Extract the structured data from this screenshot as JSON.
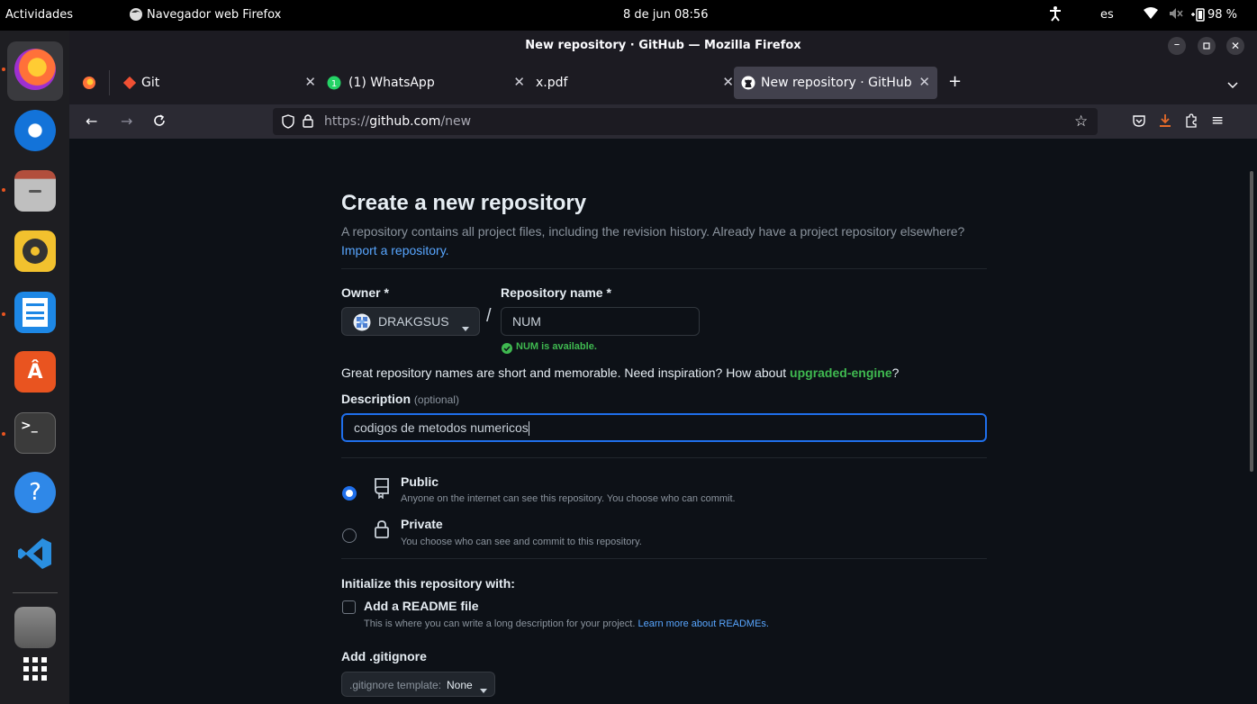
{
  "system": {
    "activities": "Actividades",
    "app_name": "Navegador web Firefox",
    "datetime": "8 de jun  08:56",
    "keyboard": "es",
    "battery": "98 %"
  },
  "dock": {
    "apps": [
      "firefox-icon",
      "thunderbird-icon",
      "files-icon",
      "rhythmbox-icon",
      "libreoffice-writer-icon",
      "software-store-icon",
      "terminal-icon",
      "help-icon",
      "vscode-icon",
      "drive-icon",
      "app-grid-icon"
    ]
  },
  "window": {
    "title": "New repository · GitHub — Mozilla Firefox"
  },
  "tabs": [
    {
      "label": "Git",
      "icon": "git-icon",
      "active": false
    },
    {
      "label": "(1) WhatsApp",
      "icon": "whatsapp-icon",
      "active": false
    },
    {
      "label": "x.pdf",
      "icon": "",
      "active": false
    },
    {
      "label": "New repository · GitHub",
      "icon": "github-icon",
      "active": true
    }
  ],
  "url": {
    "scheme": "https://",
    "host": "github.com",
    "path": "/new"
  },
  "page": {
    "title": "Create a new repository",
    "subtitle": "A repository contains all project files, including the revision history. Already have a project repository elsewhere?",
    "import_link": "Import a repository.",
    "owner_label": "Owner *",
    "owner_value": "DRAKGSUS",
    "slash": "/",
    "repo_label": "Repository name *",
    "repo_value": "NUM",
    "availability": "NUM is available.",
    "inspiration_text": "Great repository names are short and memorable. Need inspiration? How about",
    "inspiration_suggestion": "upgraded-engine",
    "inspiration_end": "?",
    "description_label": "Description",
    "description_optional": "(optional)",
    "description_value": "codigos de metodos numericos",
    "visibility": {
      "selected": "public",
      "public_title": "Public",
      "public_desc": "Anyone on the internet can see this repository. You choose who can commit.",
      "private_title": "Private",
      "private_desc": "You choose who can see and commit to this repository."
    },
    "init_title": "Initialize this repository with:",
    "readme_label": "Add a README file",
    "readme_desc": "This is where you can write a long description for your project.",
    "readme_link": "Learn more about READMEs.",
    "readme_checked": false,
    "gitignore_title": "Add .gitignore",
    "gitignore_prefix": ".gitignore template:",
    "gitignore_value": "None"
  },
  "colors": {
    "accent_blue": "#58a6ff",
    "success_green": "#3fb950",
    "focus_blue": "#1f6feb",
    "page_bg": "#0d1117"
  }
}
